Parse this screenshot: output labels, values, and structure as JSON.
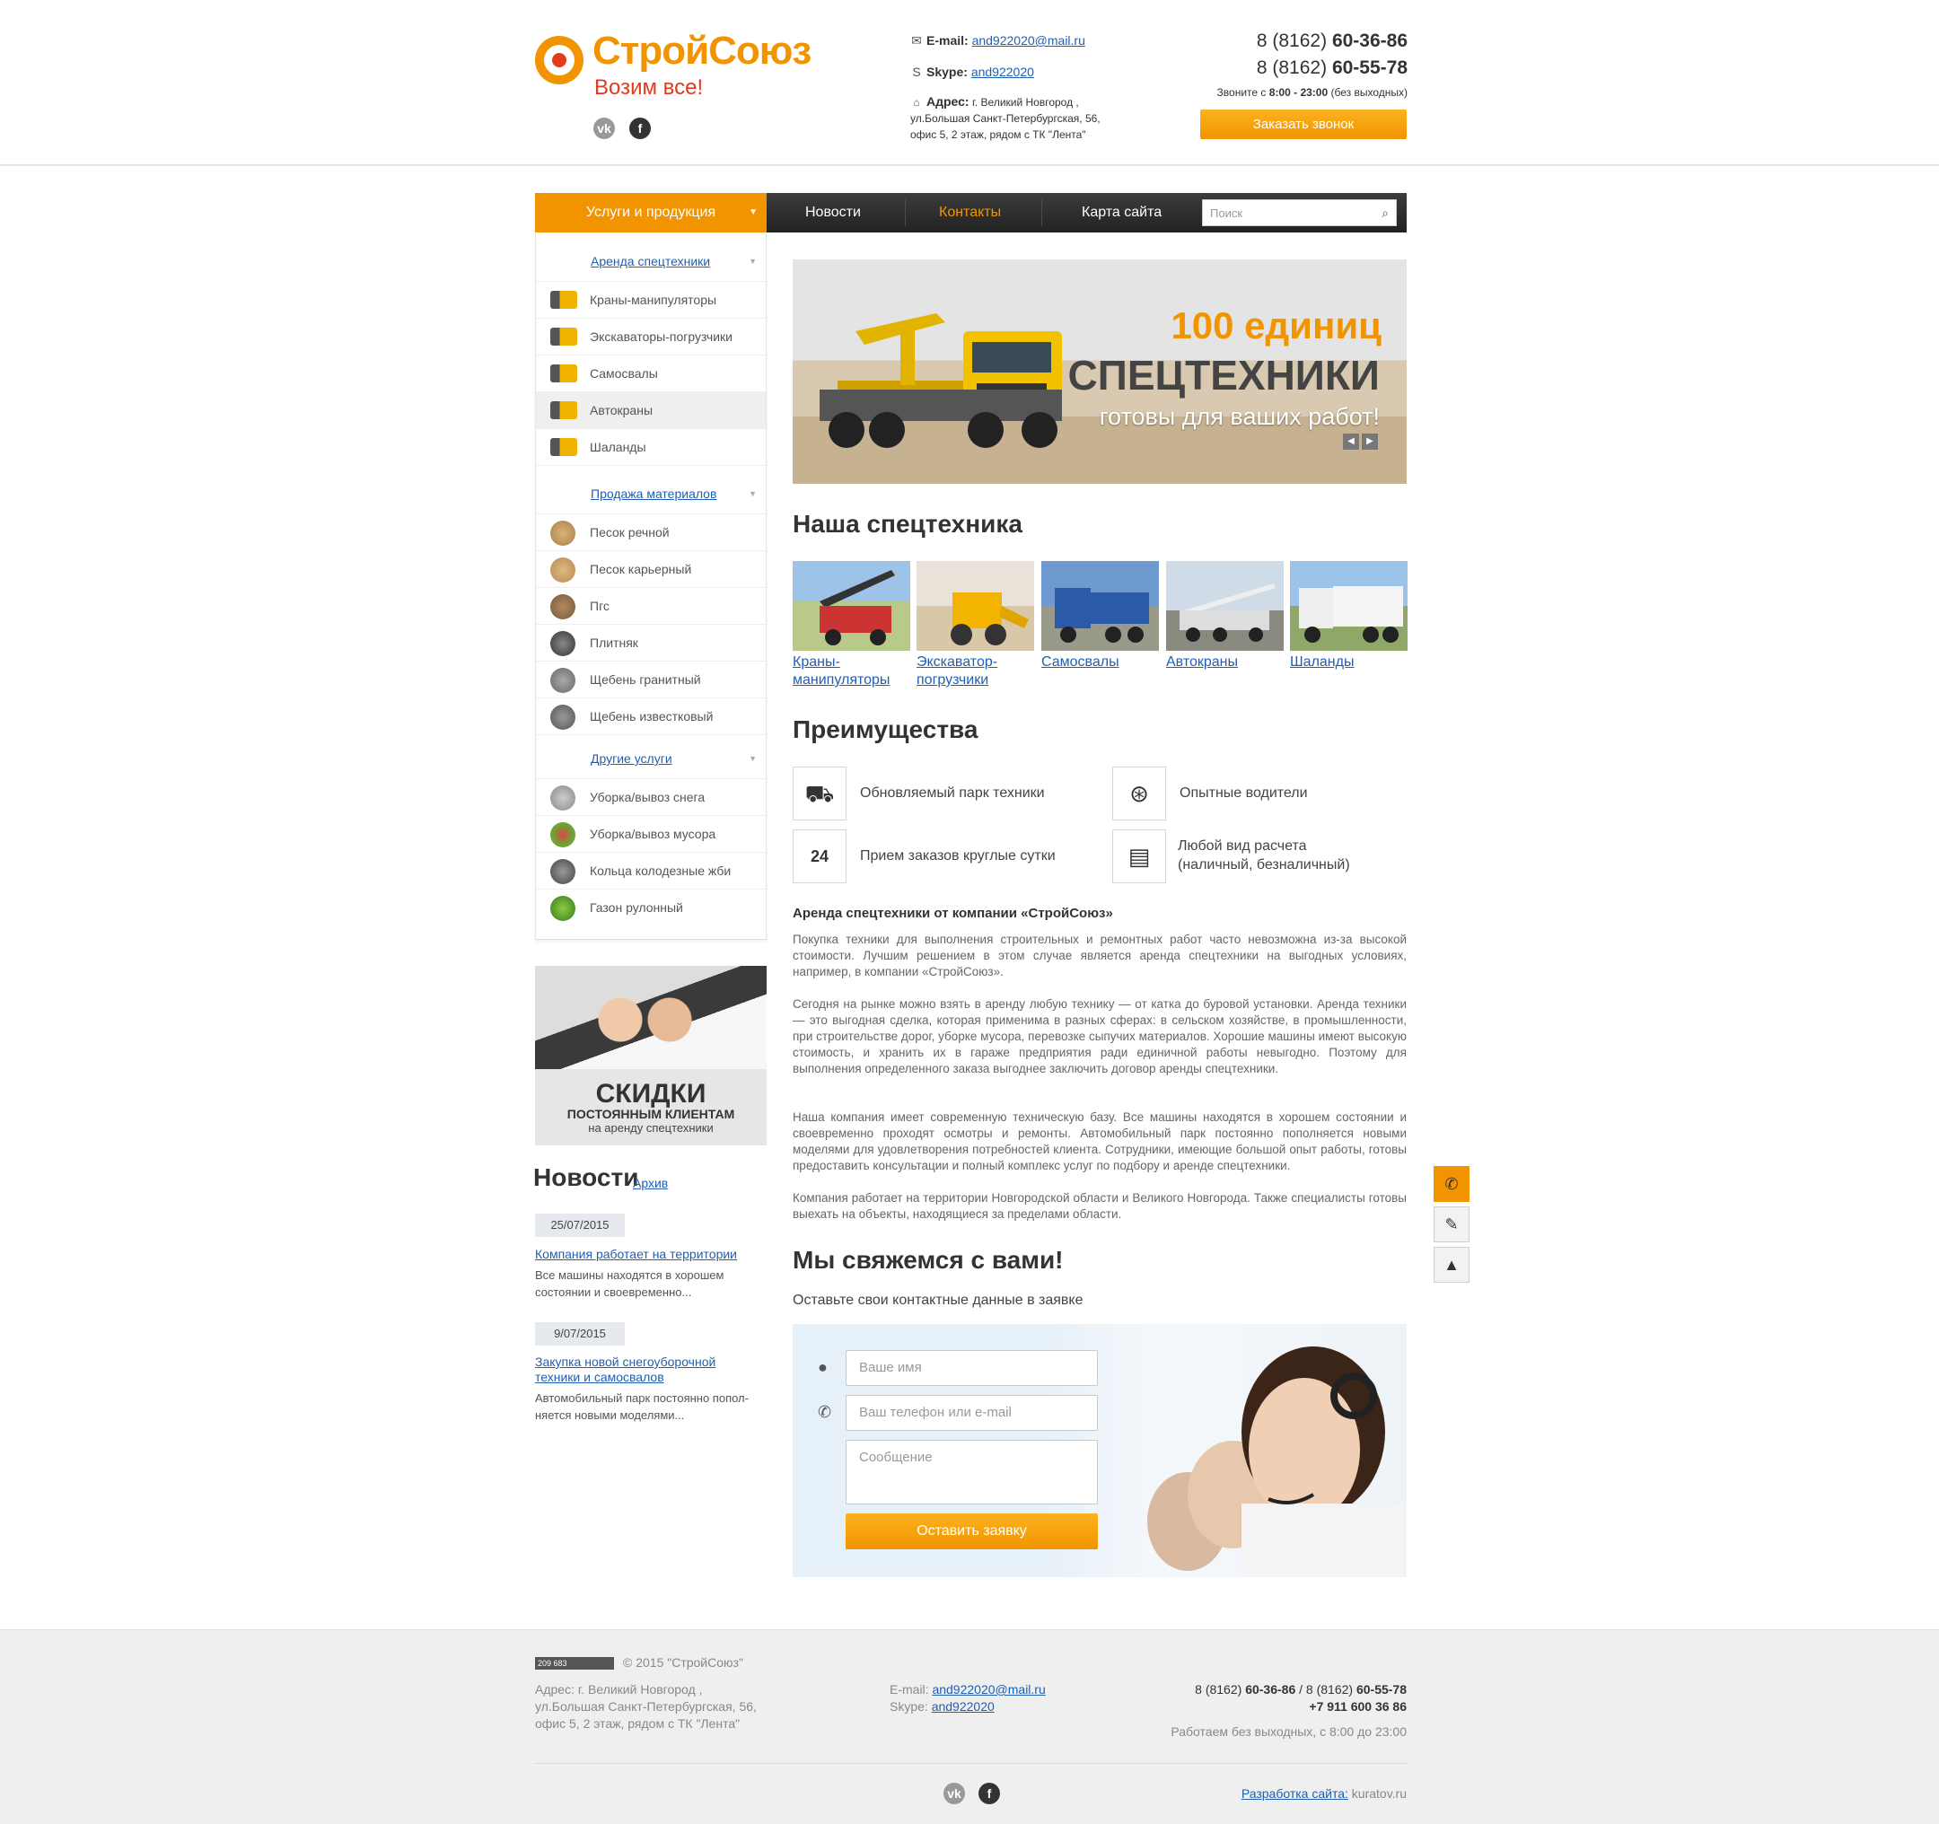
{
  "brand": {
    "name": "СтройСоюз",
    "tagline": "Возим все!",
    "colors": {
      "accent": "#f29400",
      "accent_red": "#e23a1e",
      "link": "#1f5fb3"
    }
  },
  "header": {
    "social": [
      {
        "icon": "vk-icon",
        "label": "vk"
      },
      {
        "icon": "facebook-icon",
        "label": "f"
      }
    ],
    "email_label": "E-mail:",
    "email": "and922020@mail.ru",
    "skype_label": "Skype:",
    "skype": "and922020",
    "address_label": "Адрес:",
    "address_lines": [
      "г. Великий Новгород ,",
      "ул.Большая Санкт-Петербургская, 56,",
      "офис 5, 2 этаж, рядом с ТК \"Лента\""
    ],
    "phones": [
      {
        "prefix": "8 (8162)",
        "number": "60-36-86"
      },
      {
        "prefix": "8 (8162)",
        "number": "60-55-78"
      }
    ],
    "hours_prefix": "Звоните с",
    "hours": "8:00 - 23:00",
    "hours_suffix": "(без выходных)",
    "call_button": "Заказать звонок"
  },
  "nav": {
    "products": "Услуги и продукция",
    "items": [
      "Новости",
      "Контакты",
      "Карта сайта"
    ],
    "search_placeholder": "Поиск"
  },
  "sidebar": {
    "categories": [
      {
        "title": "Аренда спецтехники",
        "items": [
          "Краны-манипуляторы",
          "Экскаваторы-погрузчики",
          "Самосвалы",
          "Автокраны",
          "Шаланды"
        ]
      },
      {
        "title": "Продажа материалов",
        "items": [
          "Песок речной",
          "Песок карьерный",
          "Пгс",
          "Плитняк",
          "Щебень гранитный",
          "Щебень известковый"
        ]
      },
      {
        "title": "Другие услуги",
        "items": [
          "Уборка/вывоз снега",
          "Уборка/вывоз мусора",
          "Кольца колодезные жби",
          "Газон рулонный"
        ]
      }
    ]
  },
  "promo": {
    "line1": "СКИДКИ",
    "line2": "ПОСТОЯННЫМ КЛИЕНТАМ",
    "line3": "на аренду спецтехники"
  },
  "news": {
    "title": "Новости",
    "archive": "Архив",
    "items": [
      {
        "date": "25/07/2015",
        "title": "Компания работает на территории",
        "text_lines": [
          "Все машины находятся в хорошем",
          "состоянии и своевременно..."
        ]
      },
      {
        "date": "9/07/2015",
        "title_lines": [
          "Закупка новой снегоуборочной",
          "техники и самосвалов"
        ],
        "text_lines": [
          "Автомобильный парк постоянно попол-",
          "няется новыми моделями..."
        ]
      }
    ]
  },
  "slider": {
    "line1": "100 единиц",
    "line2": "СПЕЦТЕХНИКИ",
    "line3": "готовы для ваших работ!"
  },
  "fleet": {
    "title": "Наша спецтехника",
    "items": [
      {
        "caption_lines": [
          "Краны-",
          "манипуляторы"
        ]
      },
      {
        "caption_lines": [
          "Экскаватор-",
          "погрузчики"
        ]
      },
      {
        "caption_lines": [
          "Самосвалы"
        ]
      },
      {
        "caption_lines": [
          "Автокраны"
        ]
      },
      {
        "caption_lines": [
          "Шаланды"
        ]
      }
    ]
  },
  "advantages": {
    "title": "Преимущества",
    "items": [
      {
        "icon": "dump-truck-icon",
        "text_lines": [
          "Обновляемый парк техники"
        ]
      },
      {
        "icon": "steering-wheel-icon",
        "text_lines": [
          "Опытные водители"
        ]
      },
      {
        "icon": "clock-24-icon",
        "text_lines": [
          "Прием заказов круглые сутки"
        ]
      },
      {
        "icon": "wallet-icon",
        "text_lines": [
          "Любой вид расчета",
          "(наличный, безналичный)"
        ]
      }
    ]
  },
  "article": {
    "title": "Аренда спецтехники от компании «СтройСоюз»",
    "paragraphs": [
      "Покупка техники для выполнения строительных и ремонтных работ часто невозможна из-за высокой стоимости. Лучшим решением в этом случае является аренда спецтехники на выгодных условиях, например, в компании «СтройСоюз».",
      "Сегодня на рынке можно взять в аренду любую технику — от катка до буровой установки. Аренда техники — это выгодная сделка, которая применима в разных сферах: в сельском хозяйстве, в промышленности, при строительстве дорог, уборке мусора, перевозке сыпучих материалов. Хорошие машины имеют высокую стоимость, и хранить их в гараже предприятия ради единичной работы невыгодно. Поэтому для выполнения определенного заказа выгоднее заключить договор аренды спецтехники.",
      "Наша компания имеет современную техническую базу. Все машины находятся в хорошем состоянии и своевременно проходят осмотры и ремонты. Автомобильный парк постоянно пополняется новыми моделями для удовлетворения потребностей клиента. Сотрудники, имеющие большой опыт работы, готовы предоставить консультации и полный комплекс услуг по подбору и аренде спецтехники.",
      "Компания работает на территории Новгородской области и Великого Новгорода. Также специалисты готовы выехать на объекты, находящиеся за пределами области."
    ]
  },
  "contact_form": {
    "title": "Мы свяжемся с вами!",
    "subtitle": "Оставьте свои контактные данные в заявке",
    "name_placeholder": "Ваше имя",
    "phone_placeholder": "Ваш телефон или e-mail",
    "message_placeholder": "Сообщение",
    "submit": "Оставить заявку"
  },
  "footer": {
    "counter": "209 683",
    "copyright": "© 2015 \"СтройСоюз\"",
    "address_lines": [
      "Адрес: г. Великий Новгород ,",
      "ул.Большая Санкт-Петербургская, 56,",
      "офис 5, 2 этаж, рядом с ТК \"Лента\""
    ],
    "email_label": "E-mail:",
    "email": "and922020@mail.ru",
    "skype_label": "Skype:",
    "skype": "and922020",
    "phone1_prefix": "8 (8162)",
    "phone1": "60-36-86",
    "phone_sep": "/",
    "phone2_prefix": "8 (8162)",
    "phone2": "60-55-78",
    "mobile": "+7 911 600 36 86",
    "hours": "Работаем без выходных, с 8:00 до 23:00",
    "dev_label": "Разработка сайта:",
    "dev_name": "kuratov.ru"
  }
}
